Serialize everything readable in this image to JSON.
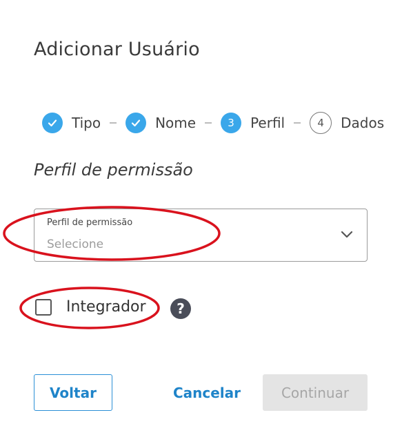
{
  "dialog": {
    "title": "Adicionar Usuário"
  },
  "stepper": {
    "steps": [
      {
        "label": "Tipo",
        "state": "done",
        "marker": ""
      },
      {
        "label": "Nome",
        "state": "done",
        "marker": ""
      },
      {
        "label": "Perfil",
        "state": "active",
        "marker": "3"
      },
      {
        "label": "Dados",
        "state": "todo",
        "marker": "4"
      }
    ]
  },
  "section": {
    "title": "Perfil de permissão"
  },
  "profile_select": {
    "label": "Perfil de permissão",
    "placeholder": "Selecione"
  },
  "integrator": {
    "label": "Integrador",
    "checked": false,
    "help_icon": "question-icon"
  },
  "actions": {
    "back_label": "Voltar",
    "cancel_label": "Cancelar",
    "continue_label": "Continuar"
  },
  "colors": {
    "accent": "#3aa7ea",
    "link": "#1f84c9",
    "annotation": "#d9121d"
  }
}
